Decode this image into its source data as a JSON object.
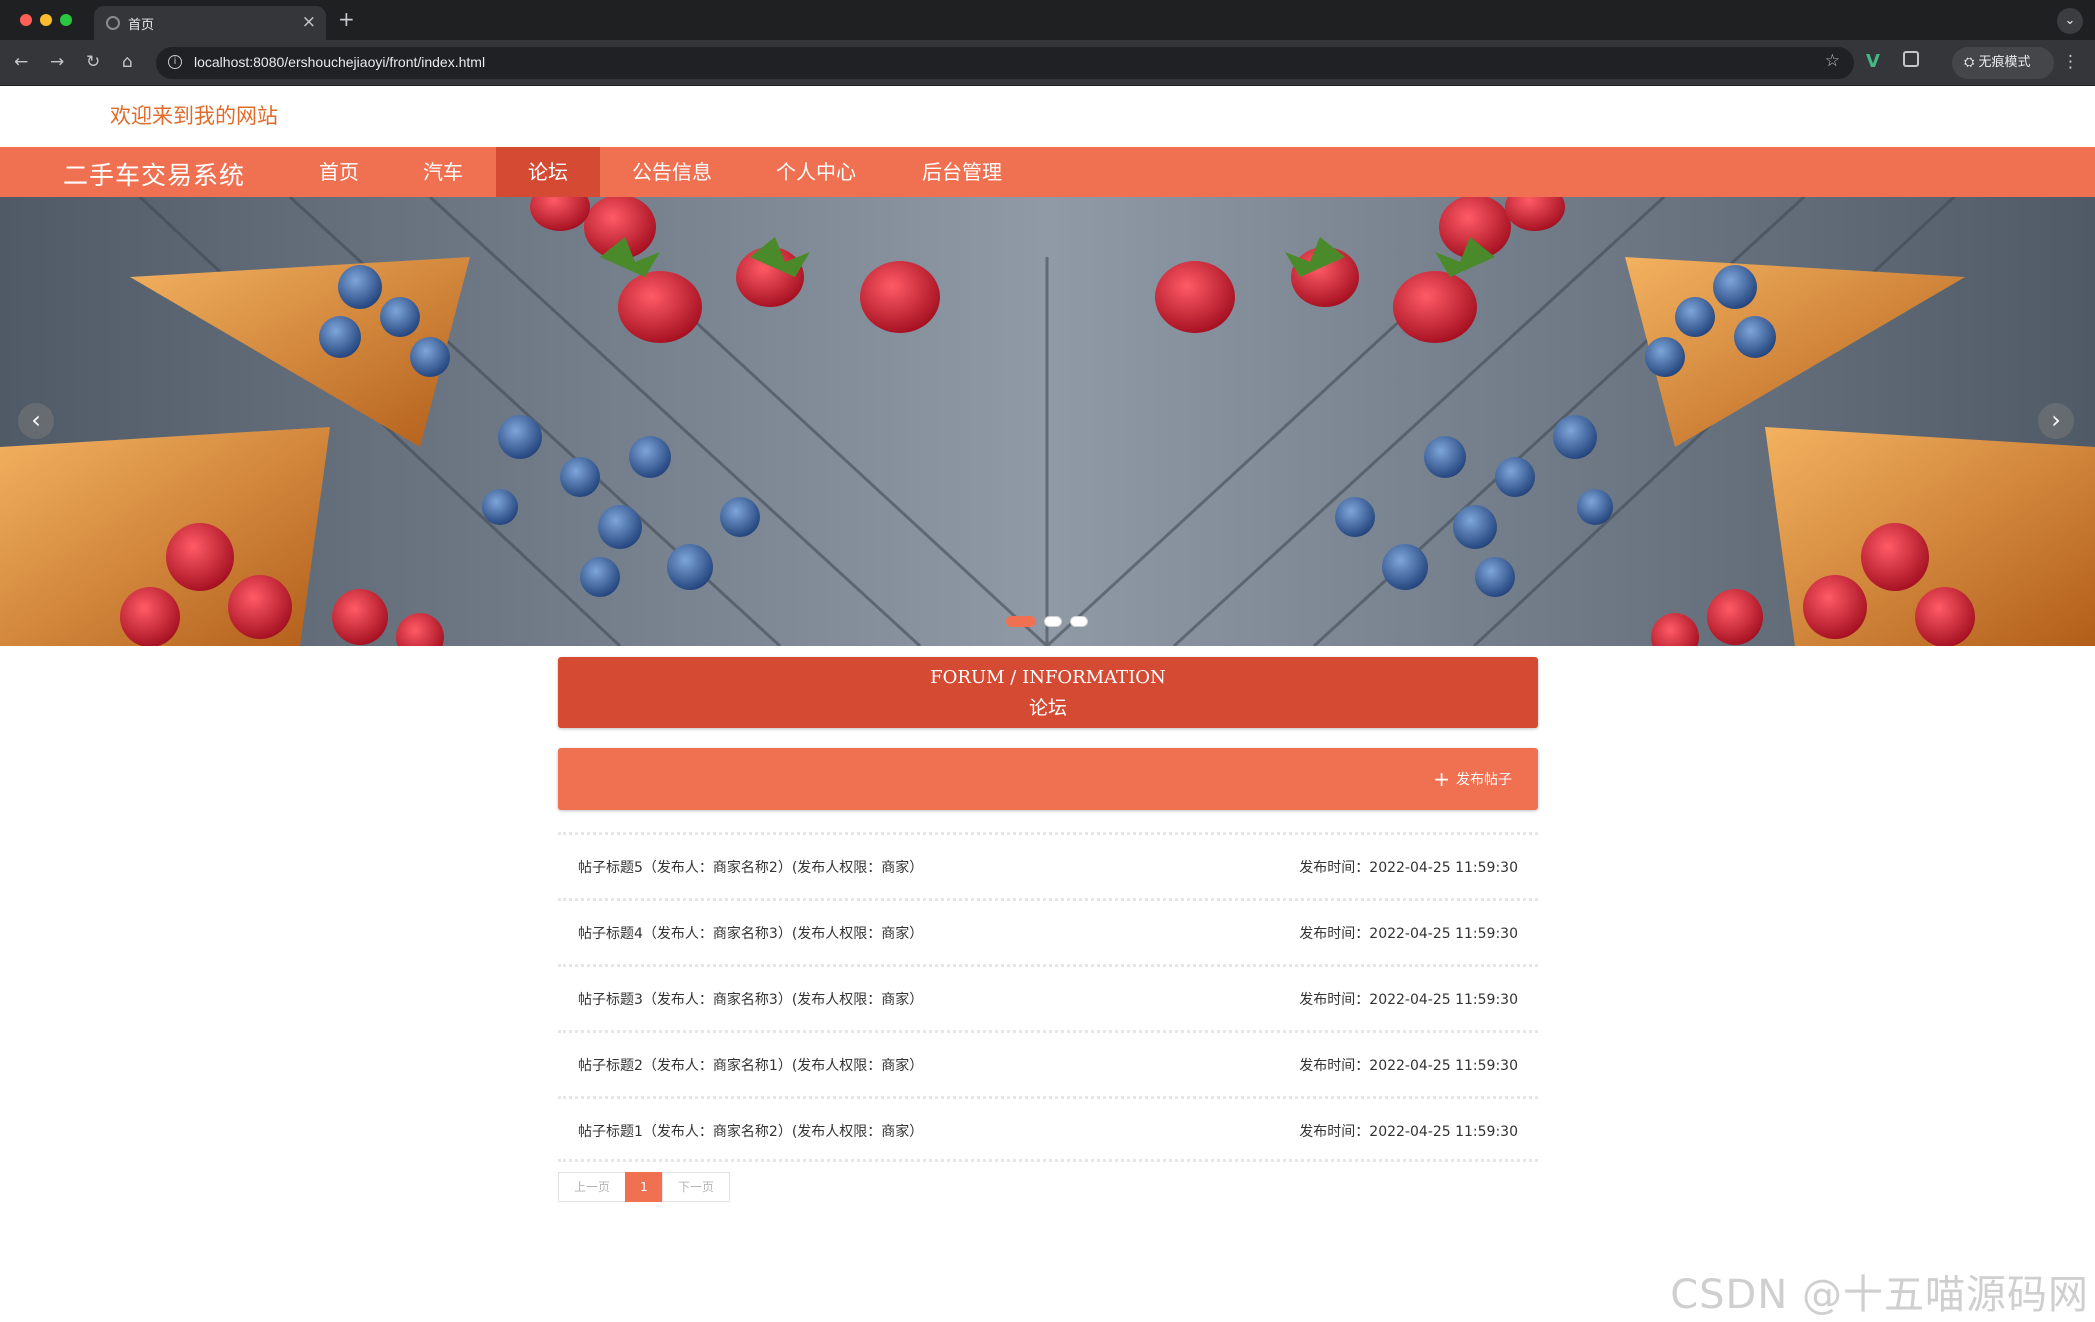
{
  "browser": {
    "tab_title": "首页",
    "tab_close": "×",
    "new_tab": "+",
    "tab_menu": "⌄",
    "url": "localhost:8080/ershouchejiaoyi/front/index.html",
    "nav": {
      "back": "←",
      "forward": "→",
      "reload": "↻",
      "home": "⌂"
    },
    "bookmark": "☆",
    "extension_v": "V",
    "incognito_label": "无痕模式",
    "menu": "⋮"
  },
  "site": {
    "welcome": "欢迎来到我的网站",
    "brand": "二手车交易系统",
    "menu": [
      {
        "label": "首页",
        "active": false
      },
      {
        "label": "汽车",
        "active": false
      },
      {
        "label": "论坛",
        "active": true
      },
      {
        "label": "公告信息",
        "active": false
      },
      {
        "label": "个人中心",
        "active": false
      },
      {
        "label": "后台管理",
        "active": false
      }
    ],
    "colors": {
      "primary": "#f07152",
      "primary_dark": "#d44a33",
      "welcome": "#e06c2c"
    }
  },
  "carousel": {
    "prev": "‹",
    "next": "›",
    "slide_count": 3,
    "active_slide": 1
  },
  "forum": {
    "title_en": "FORUM / INFORMATION",
    "title_zh": "论坛",
    "publish_icon": "+",
    "publish_label": "发布帖子",
    "posts": [
      {
        "title": "帖子标题5（发布人：商家名称2）(发布人权限：商家）",
        "time": "发布时间：2022-04-25 11:59:30"
      },
      {
        "title": "帖子标题4（发布人：商家名称3）(发布人权限：商家）",
        "time": "发布时间：2022-04-25 11:59:30"
      },
      {
        "title": "帖子标题3（发布人：商家名称3）(发布人权限：商家）",
        "time": "发布时间：2022-04-25 11:59:30"
      },
      {
        "title": "帖子标题2（发布人：商家名称1）(发布人权限：商家）",
        "time": "发布时间：2022-04-25 11:59:30"
      },
      {
        "title": "帖子标题1（发布人：商家名称2）(发布人权限：商家）",
        "time": "发布时间：2022-04-25 11:59:30"
      }
    ],
    "pagination": {
      "prev": "上一页",
      "current": "1",
      "next": "下一页"
    }
  },
  "watermark": "CSDN @十五喵源码网"
}
